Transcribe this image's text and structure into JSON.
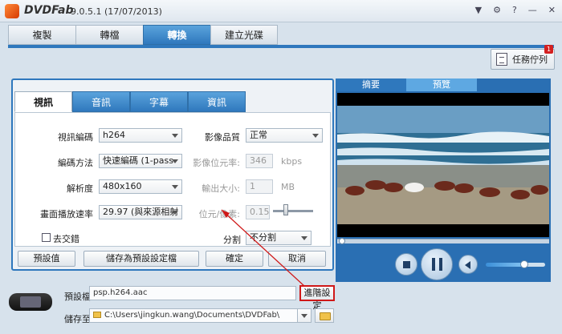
{
  "app": {
    "name": "DVDFab",
    "version": "9.0.5.1 (17/07/2013)"
  },
  "main_tabs": [
    "複製",
    "轉檔",
    "轉換",
    "建立光碟"
  ],
  "task_queue": {
    "label": "任務佇列",
    "count": "1"
  },
  "sub_tabs": [
    "視訊",
    "音訊",
    "字幕",
    "資訊"
  ],
  "video": {
    "codec_label": "視訊編碼",
    "codec_value": "h264",
    "quality_label": "影像品質",
    "quality_value": "正常",
    "method_label": "編碼方法",
    "method_value": "快速編碼 (1-pass",
    "bitrate_label": "影像位元率:",
    "bitrate_value": "346",
    "bitrate_unit": "kbps",
    "resolution_label": "解析度",
    "resolution_value": "480x160",
    "size_label": "輸出大小:",
    "size_value": "1",
    "size_unit": "MB",
    "framerate_label": "畫面播放速率",
    "framerate_value": "29.97 (與來源相射",
    "bpp_label": "位元/像素:",
    "bpp_value": "0.15",
    "deinterlace_label": "去交錯",
    "split_label": "分割",
    "split_value": "不分割"
  },
  "panel_buttons": {
    "default": "預設值",
    "save_profile": "儲存為預設設定檔",
    "ok": "確定",
    "cancel": "取消"
  },
  "preview_tabs": [
    "摘要",
    "預覽"
  ],
  "profile": {
    "label": "預設檔:",
    "value": "psp.h264.aac",
    "advanced": "進階設定"
  },
  "save_to": {
    "label": "儲存至",
    "value": "C:\\Users\\jingkun.wang\\Documents\\DVDFab\\"
  },
  "colors": {
    "accent": "#2f78bd",
    "highlight": "#d01818"
  }
}
